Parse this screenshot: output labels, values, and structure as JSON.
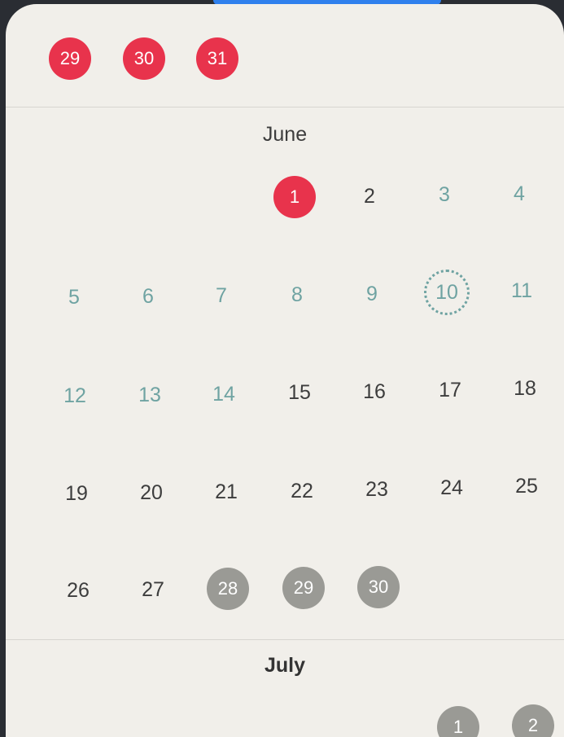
{
  "prev_month_tail": [
    "29",
    "30",
    "31"
  ],
  "june": {
    "title": "June",
    "days": [
      "1",
      "2",
      "3",
      "4",
      "5",
      "6",
      "7",
      "8",
      "9",
      "10",
      "11",
      "12",
      "13",
      "14",
      "15",
      "16",
      "17",
      "18",
      "19",
      "20",
      "21",
      "22",
      "23",
      "24",
      "25",
      "26",
      "27",
      "28",
      "29",
      "30"
    ],
    "selected_day": "1",
    "today": "10"
  },
  "july": {
    "title": "July",
    "visible_days": [
      "1",
      "2"
    ]
  },
  "colors": {
    "accent_red": "#e8334c",
    "past_teal": "#6fa3a2",
    "gray_marked": "#9a9a95",
    "background": "#f1efea"
  }
}
